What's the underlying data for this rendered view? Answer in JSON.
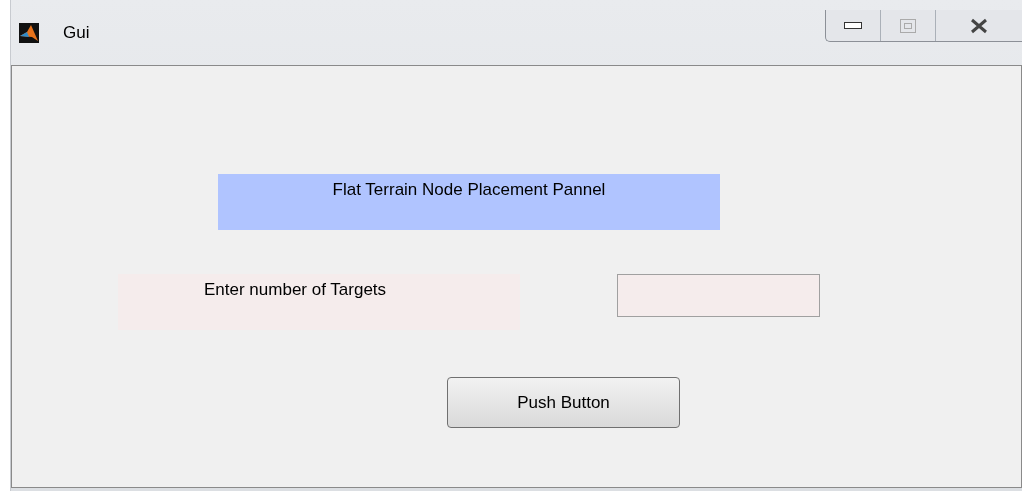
{
  "window": {
    "title": "Gui"
  },
  "title_panel": {
    "text": "Flat Terrain Node Placement Pannel"
  },
  "target_label": {
    "text": "Enter number of Targets"
  },
  "push_button": {
    "label": "Push Button"
  }
}
